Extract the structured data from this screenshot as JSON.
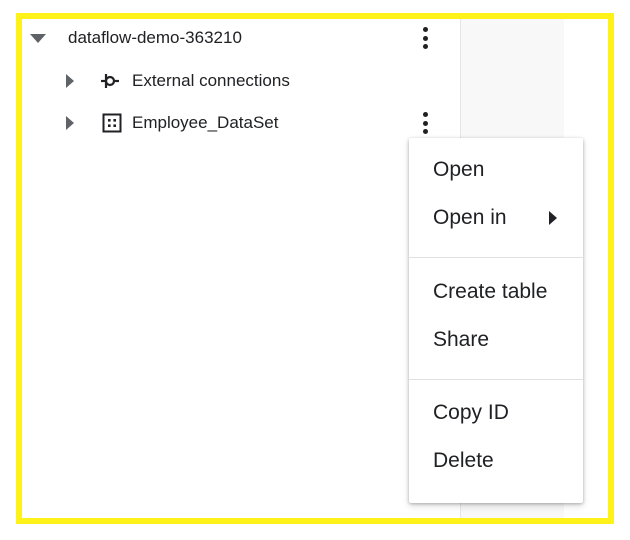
{
  "explorer": {
    "project": {
      "label": "dataflow-demo-363210",
      "expanded": true
    },
    "children": [
      {
        "label": "External connections",
        "icon": "external-connection-icon"
      },
      {
        "label": "Employee_DataSet",
        "icon": "dataset-icon"
      }
    ]
  },
  "context_menu": {
    "groups": [
      {
        "items": [
          {
            "label": "Open"
          },
          {
            "label": "Open in",
            "has_submenu": true
          }
        ]
      },
      {
        "items": [
          {
            "label": "Create table"
          },
          {
            "label": "Share"
          }
        ]
      },
      {
        "items": [
          {
            "label": "Copy ID"
          },
          {
            "label": "Delete"
          }
        ]
      }
    ]
  },
  "colors": {
    "highlight_border": "#fff21a",
    "text": "#202124",
    "icon_gray": "#5f6368"
  }
}
